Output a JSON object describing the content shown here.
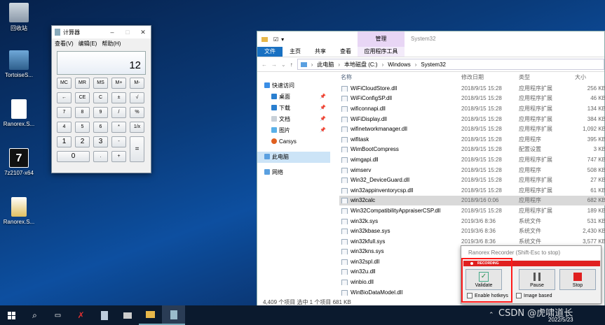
{
  "desktop": {
    "icons": [
      {
        "label": "回收站"
      },
      {
        "label": "TortoiseS..."
      },
      {
        "label": "Ranorex.S..."
      },
      {
        "label": "7z2107-x64"
      },
      {
        "label": "Ranorex.S..."
      }
    ]
  },
  "calculator": {
    "title": "计算器",
    "menu": [
      "查看(V)",
      "编辑(E)",
      "帮助(H)"
    ],
    "display_value": "12",
    "keys": [
      [
        "MC",
        "MR",
        "MS",
        "M+",
        "M-"
      ],
      [
        "←",
        "CE",
        "C",
        "±",
        "√"
      ],
      [
        "7",
        "8",
        "9",
        "/",
        "%"
      ],
      [
        "4",
        "5",
        "6",
        "*",
        "1/x"
      ],
      [
        "1",
        "2",
        "3",
        "-",
        "="
      ],
      [
        "0",
        ".",
        "+"
      ]
    ]
  },
  "explorer": {
    "title_tab_manage": "管理",
    "title_location": "System32",
    "ribbon_tabs": [
      "文件",
      "主页",
      "共享",
      "查看"
    ],
    "ribbon_app_tools": "应用程序工具",
    "breadcrumbs": [
      "此电脑",
      "本地磁盘 (C:)",
      "Windows",
      "System32"
    ],
    "nav": [
      {
        "label": "快速访问",
        "pinned": false
      },
      {
        "label": "桌面",
        "pinned": true
      },
      {
        "label": "下载",
        "pinned": true
      },
      {
        "label": "文档",
        "pinned": true
      },
      {
        "label": "图片",
        "pinned": true
      },
      {
        "label": "Carsys",
        "pinned": false
      },
      {
        "label": "此电脑",
        "pinned": false
      },
      {
        "label": "网络",
        "pinned": false
      }
    ],
    "columns": [
      "名称",
      "修改日期",
      "类型",
      "大小"
    ],
    "files": [
      {
        "name": "WiFiCloudStore.dll",
        "date": "2018/9/15 15:28",
        "type": "应用程序扩展",
        "size": "256 KB"
      },
      {
        "name": "WiFiConfigSP.dll",
        "date": "2018/9/15 15:28",
        "type": "应用程序扩展",
        "size": "46 KB"
      },
      {
        "name": "wificonnapi.dll",
        "date": "2018/9/15 15:28",
        "type": "应用程序扩展",
        "size": "134 KB"
      },
      {
        "name": "WiFiDisplay.dll",
        "date": "2018/9/15 15:28",
        "type": "应用程序扩展",
        "size": "384 KB"
      },
      {
        "name": "wifinetworkmanager.dll",
        "date": "2018/9/15 15:28",
        "type": "应用程序扩展",
        "size": "1,092 KB"
      },
      {
        "name": "wifitask",
        "date": "2018/9/15 15:28",
        "type": "应用程序",
        "size": "395 KB"
      },
      {
        "name": "WimBootCompress",
        "date": "2018/9/15 15:28",
        "type": "配置设置",
        "size": "3 KB"
      },
      {
        "name": "wimgapi.dll",
        "date": "2018/9/15 15:28",
        "type": "应用程序扩展",
        "size": "747 KB"
      },
      {
        "name": "wimserv",
        "date": "2018/9/15 15:28",
        "type": "应用程序",
        "size": "508 KB"
      },
      {
        "name": "Win32_DeviceGuard.dll",
        "date": "2018/9/15 15:28",
        "type": "应用程序扩展",
        "size": "27 KB"
      },
      {
        "name": "win32appinventorycsp.dll",
        "date": "2018/9/15 15:28",
        "type": "应用程序扩展",
        "size": "61 KB"
      },
      {
        "name": "win32calc",
        "date": "2018/9/16 0:06",
        "type": "应用程序",
        "size": "682 KB",
        "selected": true
      },
      {
        "name": "Win32CompatibilityAppraiserCSP.dll",
        "date": "2018/9/15 15:28",
        "type": "应用程序扩展",
        "size": "189 KB"
      },
      {
        "name": "win32k.sys",
        "date": "2019/3/6 8:36",
        "type": "系统文件",
        "size": "531 KB"
      },
      {
        "name": "win32kbase.sys",
        "date": "2019/3/6 8:36",
        "type": "系统文件",
        "size": "2,430 KB"
      },
      {
        "name": "win32kfull.sys",
        "date": "2019/3/6 8:36",
        "type": "系统文件",
        "size": "3,577 KB"
      },
      {
        "name": "win32kns.sys",
        "date": "",
        "type": "",
        "size": ""
      },
      {
        "name": "win32spl.dll",
        "date": "",
        "type": "",
        "size": ""
      },
      {
        "name": "win32u.dll",
        "date": "",
        "type": "",
        "size": ""
      },
      {
        "name": "winbio.dll",
        "date": "",
        "type": "",
        "size": ""
      },
      {
        "name": "WinBioDataModel.dll",
        "date": "",
        "type": "",
        "size": ""
      }
    ],
    "status": "4,409 个项目   选中 1 个项目  681 KB"
  },
  "ranorex": {
    "title": "Ranorex Recorder (Shift-Esc to stop)",
    "recording_label": "RECORDING",
    "validate_label": "Validate",
    "pause_label": "Pause",
    "stop_label": "Stop",
    "enable_hotkeys_label": "Enable hotkeys",
    "image_based_label": "Image based"
  },
  "taskbar": {
    "watermark": "CSDN @虎啸道长",
    "date": "2022/5/23"
  },
  "colors": {
    "accent": "#1971c2",
    "recording": "#e02020",
    "selected_row": "#d9d9d9"
  }
}
